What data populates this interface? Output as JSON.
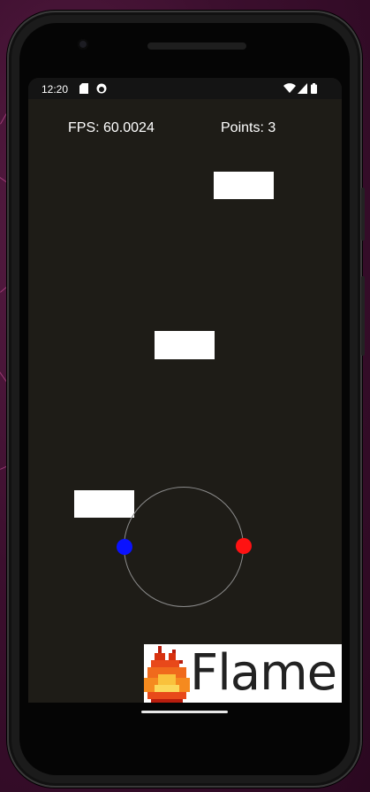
{
  "status_bar": {
    "time": "12:20",
    "left_icons": [
      "sd-card-icon",
      "app-notification-icon"
    ],
    "right_icons": [
      "wifi-icon",
      "signal-icon",
      "battery-icon"
    ]
  },
  "game": {
    "fps_text": "FPS: 60.0024",
    "points_text": "Points: 3",
    "joystick": {
      "left_dot_color": "#0a12ff",
      "right_dot_color": "#ff1212"
    },
    "logo": {
      "text": "Flame",
      "icon": "flame-icon"
    }
  },
  "colors": {
    "game_background": "#1e1c17",
    "block": "#ffffff",
    "hud_text": "#ffffff"
  }
}
